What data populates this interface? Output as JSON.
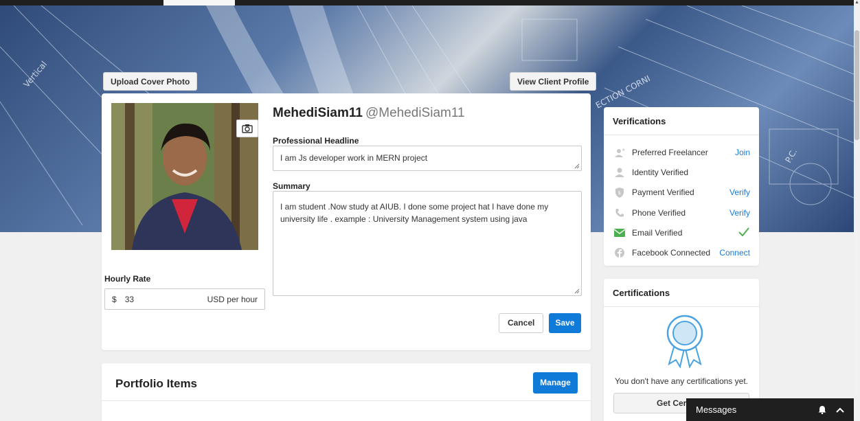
{
  "cover": {
    "upload_label": "Upload Cover Photo",
    "view_client_label": "View Client Profile"
  },
  "profile": {
    "display_name": "MehediSiam11",
    "handle": "@MehediSiam11",
    "headline_label": "Professional Headline",
    "headline_value": "I am Js developer work in MERN project",
    "summary_label": "Summary",
    "summary_value": "I am student .Now study at AIUB. I done some project hat I have done my university life . example : University Management system using java",
    "hourly_label": "Hourly Rate",
    "currency_symbol": "$",
    "hourly_value": "33",
    "hourly_unit": "USD per hour",
    "cancel_label": "Cancel",
    "save_label": "Save"
  },
  "portfolio": {
    "title": "Portfolio Items",
    "manage_label": "Manage"
  },
  "verifications": {
    "title": "Verifications",
    "items": [
      {
        "label": "Preferred Freelancer",
        "action": "Join",
        "icon": "preferred-freelancer-icon"
      },
      {
        "label": "Identity Verified",
        "action": "",
        "icon": "identity-icon"
      },
      {
        "label": "Payment Verified",
        "action": "Verify",
        "icon": "shield-icon"
      },
      {
        "label": "Phone Verified",
        "action": "Verify",
        "icon": "phone-icon"
      },
      {
        "label": "Email Verified",
        "action": "",
        "icon": "email-icon",
        "verified": true
      },
      {
        "label": "Facebook Connected",
        "action": "Connect",
        "icon": "facebook-icon"
      }
    ]
  },
  "certifications": {
    "title": "Certifications",
    "empty_text": "You don't have any certifications yet.",
    "get_label": "Get Certified"
  },
  "messages": {
    "label": "Messages"
  },
  "colors": {
    "accent": "#0f7ad8",
    "link": "#1a7ad4",
    "verified_green": "#4caf50",
    "messages_bar": "#1f1f1f"
  }
}
